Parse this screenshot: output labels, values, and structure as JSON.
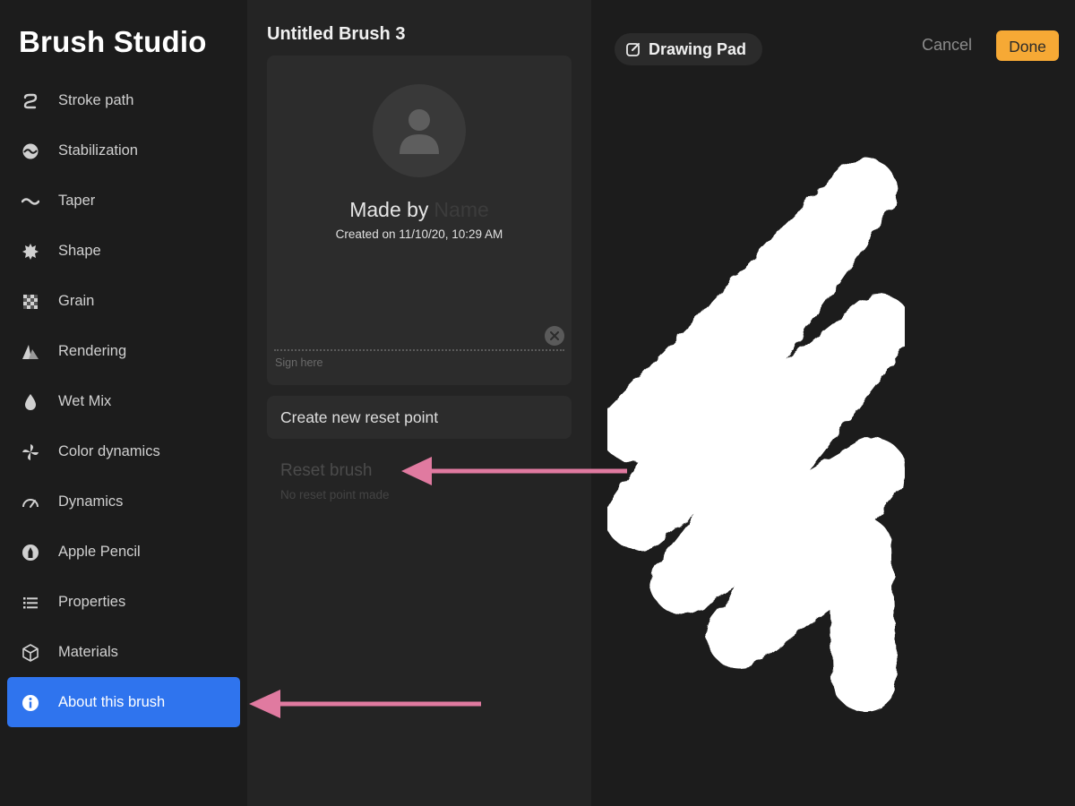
{
  "sidebar": {
    "title": "Brush Studio",
    "items": [
      {
        "label": "Stroke path",
        "icon": "stroke-path-icon"
      },
      {
        "label": "Stabilization",
        "icon": "stabilization-icon"
      },
      {
        "label": "Taper",
        "icon": "taper-icon"
      },
      {
        "label": "Shape",
        "icon": "shape-icon"
      },
      {
        "label": "Grain",
        "icon": "grain-icon"
      },
      {
        "label": "Rendering",
        "icon": "rendering-icon"
      },
      {
        "label": "Wet Mix",
        "icon": "wet-mix-icon"
      },
      {
        "label": "Color dynamics",
        "icon": "color-dynamics-icon"
      },
      {
        "label": "Dynamics",
        "icon": "dynamics-gauge-icon"
      },
      {
        "label": "Apple Pencil",
        "icon": "apple-pencil-icon"
      },
      {
        "label": "Properties",
        "icon": "properties-list-icon"
      },
      {
        "label": "Materials",
        "icon": "materials-cube-icon"
      },
      {
        "label": "About this brush",
        "icon": "info-icon",
        "active": true
      }
    ]
  },
  "about": {
    "brush_name": "Untitled Brush 3",
    "made_by_label": "Made by",
    "author": "Name",
    "created": "Created on 11/10/20, 10:29 AM",
    "signature_placeholder": "Sign here",
    "create_reset_label": "Create new reset point",
    "reset_label": "Reset brush",
    "reset_sub": "No reset point made"
  },
  "drawing_pad": {
    "title": "Drawing Pad",
    "cancel_label": "Cancel",
    "done_label": "Done"
  },
  "colors": {
    "accent": "#2f74ee",
    "done": "#f6a935",
    "annotation_arrow": "#e07aa0"
  }
}
